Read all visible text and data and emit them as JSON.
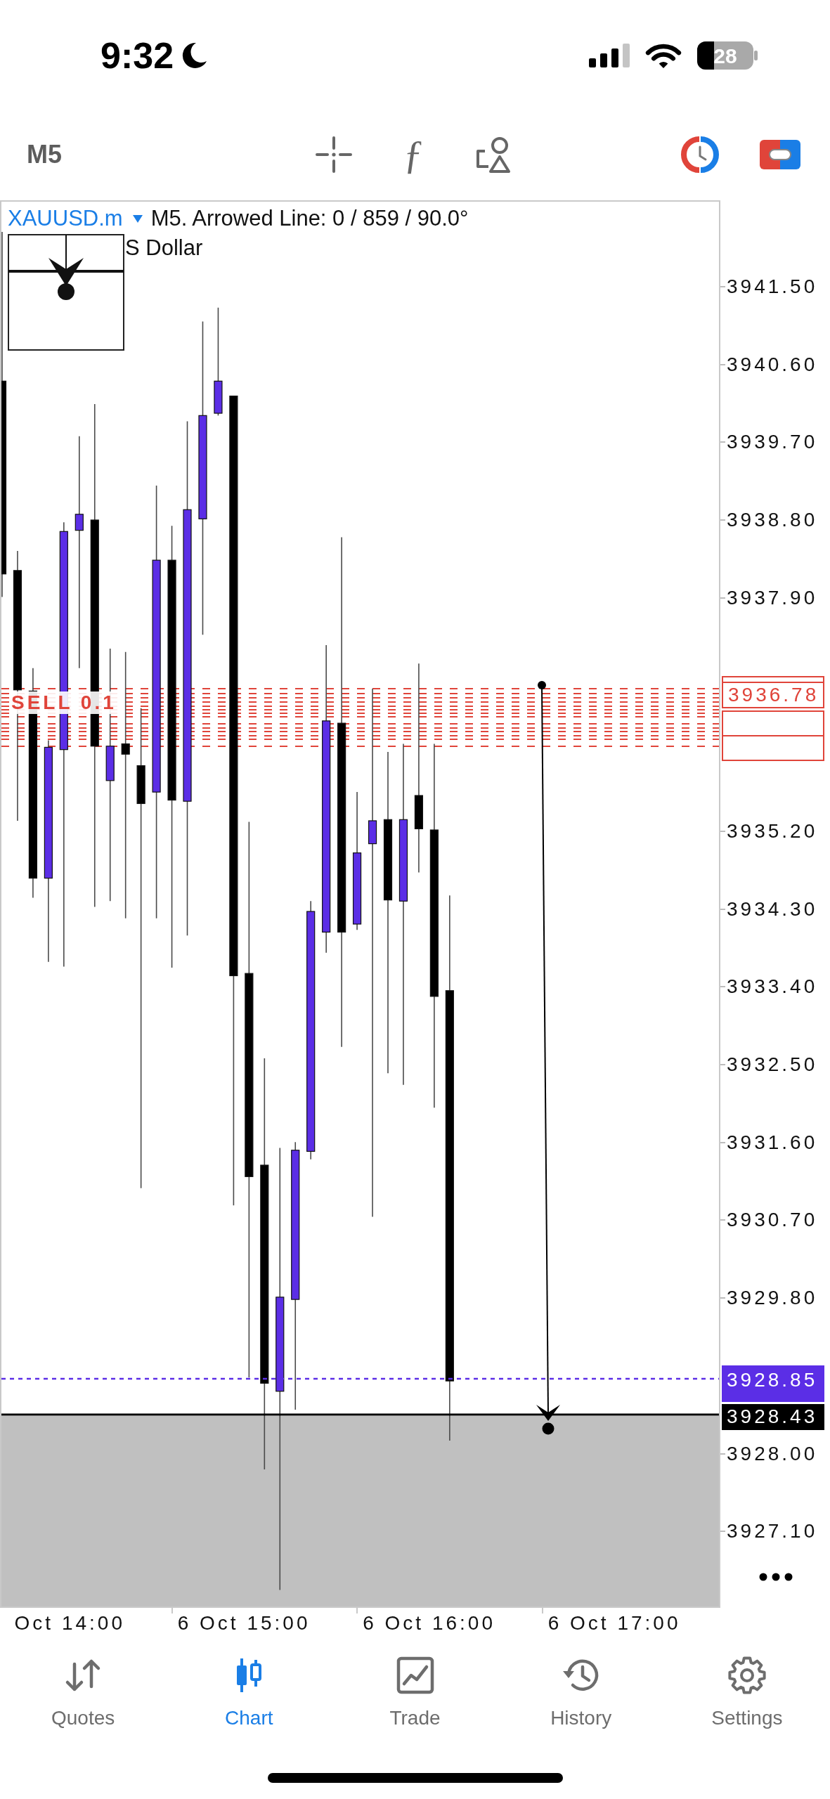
{
  "status_bar": {
    "time": "9:32",
    "battery": "28"
  },
  "toolbar": {
    "timeframe": "M5",
    "indicators": "ƒ"
  },
  "chart": {
    "symbol": "XAUUSD.m",
    "header": "M5. Arrowed Line: 0 / 859 / 90.0°",
    "description": "S Dollar",
    "order_label": "SELL 0.1",
    "order_price": "3936.78",
    "ask_price": "3928.85",
    "bid_price": "3928.43",
    "price_axis": [
      "3941.50",
      "3940.60",
      "3939.70",
      "3938.80",
      "3937.90",
      "3935.20",
      "3934.30",
      "3933.40",
      "3932.50",
      "3931.60",
      "3930.70",
      "3929.80",
      "3928.00",
      "3927.10"
    ],
    "time_axis": [
      "Oct 14:00",
      "6 Oct 15:00",
      "6 Oct 16:00",
      "6 Oct 17:00"
    ]
  },
  "tabs": [
    {
      "label": "Quotes",
      "selected": false
    },
    {
      "label": "Chart",
      "selected": true
    },
    {
      "label": "Trade",
      "selected": false
    },
    {
      "label": "History",
      "selected": false
    },
    {
      "label": "Settings",
      "selected": false
    }
  ]
}
